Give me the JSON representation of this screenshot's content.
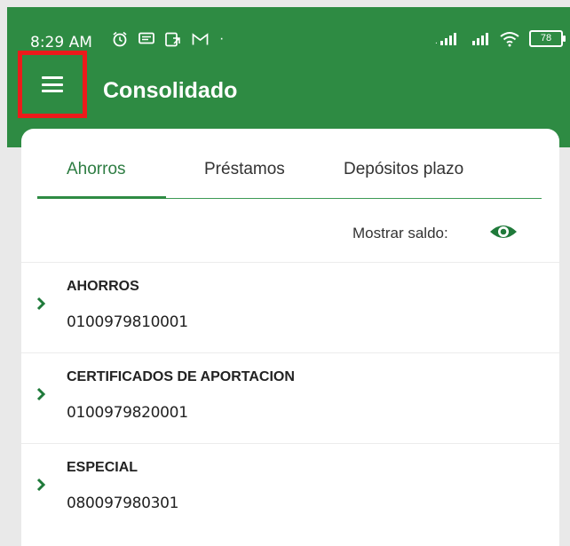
{
  "status_bar": {
    "time": "8:29 AM",
    "separator": "·",
    "battery": "78",
    "icons": [
      "alarm-icon",
      "message-icon",
      "screen-cast-icon",
      "gmail-icon",
      "signal-icon",
      "signal-icon",
      "wifi-icon",
      "battery-icon"
    ]
  },
  "header": {
    "title": "Consolidado",
    "menu_icon": "hamburger-menu-icon",
    "background": "#2e8b43",
    "highlight": "#ec1b1b"
  },
  "tabs": [
    {
      "label": "Ahorros",
      "active": true
    },
    {
      "label": "Préstamos",
      "active": false
    },
    {
      "label": "Depósitos plazo",
      "active": false
    }
  ],
  "balance": {
    "label": "Mostrar saldo:",
    "icon": "eye-icon"
  },
  "accounts": [
    {
      "name": "AHORROS",
      "number": "0100979810001"
    },
    {
      "name": "CERTIFICADOS DE APORTACION",
      "number": "0100979820001"
    },
    {
      "name": "ESPECIAL",
      "number": "080097980301"
    }
  ]
}
